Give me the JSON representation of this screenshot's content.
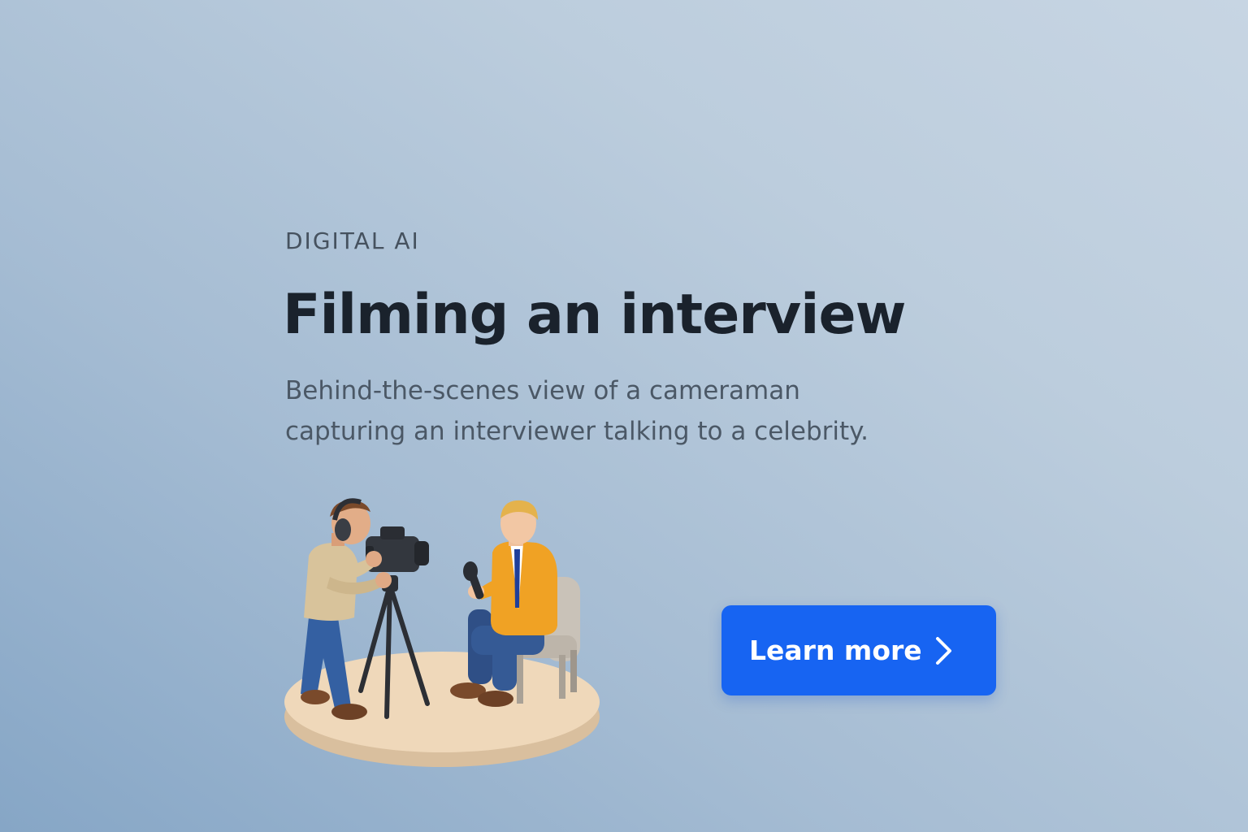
{
  "hero": {
    "eyebrow": "DIGITAL AI",
    "title": "Filming an interview",
    "description_line1": "Behind-the-scenes view of a cameraman",
    "description_line2": "capturing an interviewer talking to a celebrity."
  },
  "cta": {
    "label": "Learn more",
    "icon": "chevron-right-icon",
    "color": "#1764f2"
  },
  "illustration": {
    "subject": "cameraman-filming-seated-interviewer-icon"
  }
}
